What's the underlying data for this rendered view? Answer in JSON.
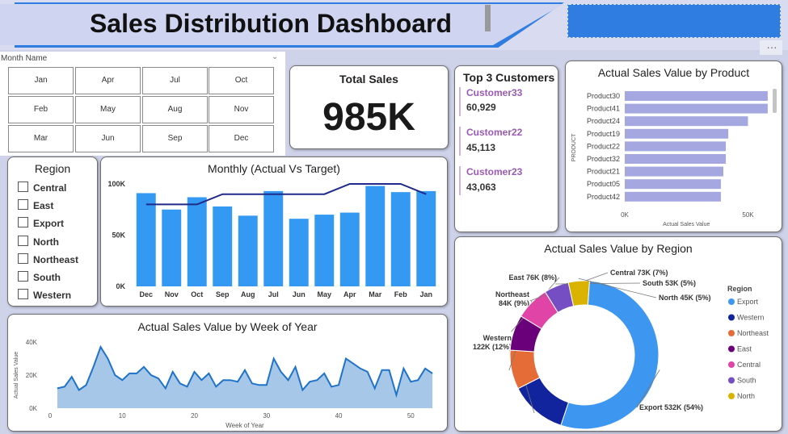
{
  "header": {
    "title": "Sales Distribution Dashboard",
    "more_label": "···"
  },
  "month_slicer": {
    "label": "Month Name",
    "months": [
      "Jan",
      "Apr",
      "Jul",
      "Oct",
      "Feb",
      "May",
      "Aug",
      "Nov",
      "Mar",
      "Jun",
      "Sep",
      "Dec"
    ]
  },
  "total_sales": {
    "title": "Total Sales",
    "value": "985K"
  },
  "top_customers": {
    "title": "Top 3 Customers",
    "items": [
      {
        "name": "Customer33",
        "value": "60,929"
      },
      {
        "name": "Customer22",
        "value": "45,113"
      },
      {
        "name": "Customer23",
        "value": "43,063"
      }
    ]
  },
  "region_slicer": {
    "title": "Region",
    "items": [
      "Central",
      "East",
      "Export",
      "North",
      "Northeast",
      "South",
      "Western"
    ]
  },
  "colors": {
    "bar_blue": "#3399f3",
    "target_line": "#1f2a8a",
    "product_bar": "#a4a7e0",
    "area_line": "#1f73c9",
    "area_fill": "#a7c7e9",
    "customer_name": "#9b59b6"
  },
  "chart_data": [
    {
      "type": "bar",
      "title": "Monthly (Actual Vs Target)",
      "categories": [
        "Dec",
        "Nov",
        "Oct",
        "Sep",
        "Aug",
        "Jul",
        "Jun",
        "May",
        "Apr",
        "Mar",
        "Feb",
        "Jan"
      ],
      "series": [
        {
          "kind": "bar",
          "values": [
            91000,
            75000,
            87000,
            78000,
            69000,
            93000,
            66000,
            70000,
            72000,
            98000,
            92000,
            93000
          ]
        },
        {
          "kind": "line",
          "values": [
            80000,
            80000,
            80000,
            90000,
            90000,
            90000,
            90000,
            90000,
            100000,
            100000,
            100000,
            90000
          ]
        }
      ],
      "yticks": [
        "0K",
        "50K",
        "100K"
      ],
      "ylim": [
        0,
        100000
      ]
    },
    {
      "type": "bar",
      "orientation": "horizontal",
      "title": "Actual Sales Value by Product",
      "xlabel": "Actual Sales Value",
      "ylabel": "PRODUCT",
      "categories": [
        "Product30",
        "Product41",
        "Product24",
        "Product19",
        "Product22",
        "Product32",
        "Product21",
        "Product05",
        "Product42"
      ],
      "values": [
        58000,
        58000,
        50000,
        42000,
        41000,
        41000,
        40000,
        39000,
        39000
      ],
      "xticks": [
        "0K",
        "50K"
      ],
      "xlim": [
        0,
        60000
      ]
    },
    {
      "type": "area",
      "title": "Actual Sales Value by Week of Year",
      "xlabel": "Week of Year",
      "ylabel": "Actual Sales Value",
      "x": [
        1,
        2,
        3,
        4,
        5,
        6,
        7,
        8,
        9,
        10,
        11,
        12,
        13,
        14,
        15,
        16,
        17,
        18,
        19,
        20,
        21,
        22,
        23,
        24,
        25,
        26,
        27,
        28,
        29,
        30,
        31,
        32,
        33,
        34,
        35,
        36,
        37,
        38,
        39,
        40,
        41,
        42,
        43,
        44,
        45,
        46,
        47,
        48,
        49,
        50,
        51,
        52,
        53
      ],
      "values": [
        12000,
        13000,
        19000,
        11000,
        14000,
        25000,
        37000,
        30000,
        20000,
        17000,
        21000,
        21000,
        25000,
        20000,
        18000,
        12000,
        22000,
        15000,
        13000,
        22000,
        17000,
        21000,
        13000,
        17000,
        17000,
        16000,
        23000,
        15000,
        14000,
        14000,
        30000,
        22000,
        17000,
        25000,
        11000,
        16000,
        17000,
        21000,
        13000,
        14000,
        30000,
        27000,
        24000,
        22000,
        12000,
        23000,
        23000,
        8000,
        24000,
        16000,
        17000,
        24000,
        21000
      ],
      "xticks": [
        0,
        10,
        20,
        30,
        40,
        50
      ],
      "yticks": [
        "0K",
        "20K",
        "40K"
      ],
      "ylim": [
        0,
        40000
      ],
      "xlim": [
        0,
        54
      ]
    },
    {
      "type": "pie",
      "variant": "donut",
      "title": "Actual Sales Value by Region",
      "legend_title": "Region",
      "legend_position": "right",
      "slices": [
        {
          "name": "Export",
          "label": "Export 532K (54%)",
          "value": 532,
          "color": "#3d96f0"
        },
        {
          "name": "Western",
          "label": "Western\n122K (12%)",
          "value": 122,
          "color": "#12239e"
        },
        {
          "name": "Northeast",
          "label": "Northeast\n84K (9%)",
          "value": 84,
          "color": "#e66c37"
        },
        {
          "name": "East",
          "label": "East 76K (8%)",
          "value": 76,
          "color": "#6b007b"
        },
        {
          "name": "Central",
          "label": "Central 73K (7%)",
          "value": 73,
          "color": "#e044a7"
        },
        {
          "name": "South",
          "label": "South 53K (5%)",
          "value": 53,
          "color": "#744ec2"
        },
        {
          "name": "North",
          "label": "North 45K (5%)",
          "value": 45,
          "color": "#d9b300"
        }
      ]
    }
  ]
}
